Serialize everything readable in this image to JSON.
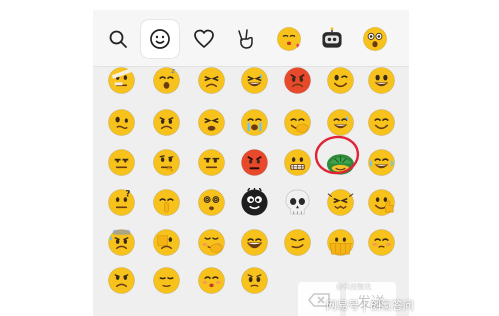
{
  "colors": {
    "panel_bg": "#efefef",
    "tab_bg": "#f6f6f6",
    "emoji_yellow": "#f8c21c",
    "emoji_red": "#e8492b",
    "emoji_black": "#1e1e1e",
    "emoji_green": "#2f8a3a",
    "selection_ring": "#e02436",
    "disabled_text": "#c9c9c9"
  },
  "tabs": [
    {
      "icon": "search-icon"
    },
    {
      "icon": "smiley-icon",
      "selected": true
    },
    {
      "icon": "heart-icon"
    },
    {
      "icon": "victory-hand-icon"
    },
    {
      "icon": "kiss-emoji-icon"
    },
    {
      "icon": "robot-sticker-icon"
    },
    {
      "icon": "shocked-emoji-icon"
    }
  ],
  "emoji_grid": {
    "rows": [
      [
        "bandaged-face",
        "sleepy-face",
        "squinting-face",
        "sweating-face",
        "angry-face",
        "winking-face",
        "grinning-face"
      ],
      [
        "confused-face",
        "worried-face",
        "tired-face",
        "crying-face",
        "hugging-face",
        "sweat-smile-face",
        "smiling-face"
      ],
      [
        "unamused-face",
        "thinking-face",
        "neutral-face",
        "angry-red-face",
        "grimacing-face",
        "turtle-face",
        "laughing-tears-face"
      ],
      [
        "questioning-face",
        "shushing-face",
        "dizzy-face",
        "black-smiling-face",
        "skull-face",
        "wincing-face",
        "thumbs-up-face"
      ],
      [
        "anxious-face",
        "face-palm-face",
        "zipper-face",
        "big-grin-face",
        "sly-face",
        "covering-face",
        "blushing-face"
      ],
      [
        "frowning-face",
        "disappointed-face",
        "pouting-face",
        "sad-face",
        "",
        "",
        ""
      ]
    ],
    "selected_item": "turtle-face"
  },
  "actions": {
    "backspace_icon": "backspace-icon",
    "send_label": "发送"
  },
  "watermark": {
    "text": "网易号 | 创氪答问",
    "small_text": "@科技微讯"
  }
}
